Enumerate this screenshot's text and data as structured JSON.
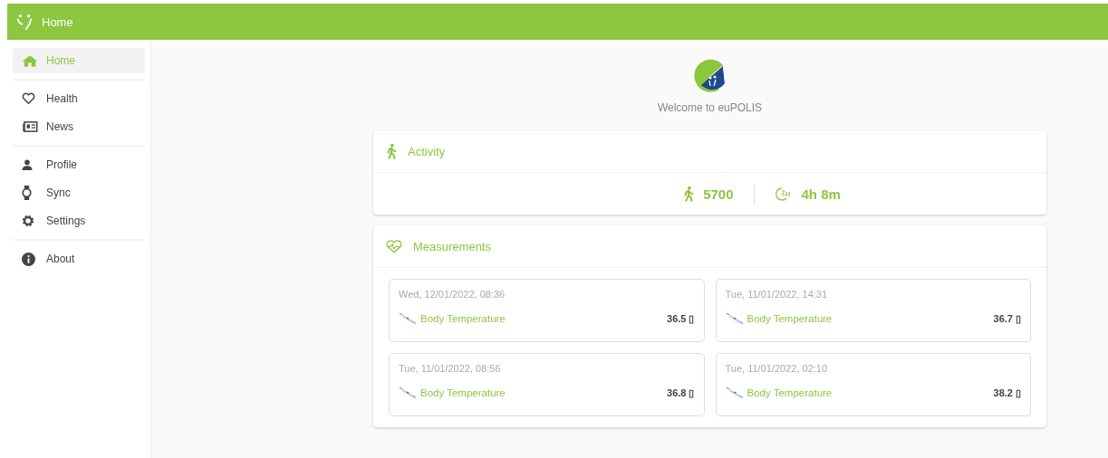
{
  "app_bar": {
    "title": "Home"
  },
  "sidebar": {
    "groups": [
      {
        "items": [
          {
            "label": "Home",
            "kind": "home",
            "selected": true
          }
        ]
      },
      {
        "items": [
          {
            "label": "Health",
            "kind": "heart",
            "selected": false
          },
          {
            "label": "News",
            "kind": "news",
            "selected": false
          }
        ]
      },
      {
        "items": [
          {
            "label": "Profile",
            "kind": "person",
            "selected": false
          },
          {
            "label": "Sync",
            "kind": "watch",
            "selected": false
          },
          {
            "label": "Settings",
            "kind": "gear",
            "selected": false
          }
        ]
      },
      {
        "items": [
          {
            "label": "About",
            "kind": "info",
            "selected": false
          }
        ]
      }
    ]
  },
  "welcome": {
    "text": "Welcome to euPOLIS"
  },
  "activity": {
    "title": "Activity",
    "steps": "5700",
    "sleep": "4h 8m"
  },
  "measurements": {
    "title": "Measurements",
    "items": [
      {
        "date": "Wed, 12/01/2022, 08:36",
        "name": "Body Temperature",
        "value": "36.5 ▯"
      },
      {
        "date": "Tue, 11/01/2022, 14:31",
        "name": "Body Temperature",
        "value": "36.7 ▯"
      },
      {
        "date": "Tue, 11/01/2022, 08:56",
        "name": "Body Temperature",
        "value": "36.8 ▯"
      },
      {
        "date": "Tue, 11/01/2022, 02:10",
        "name": "Body Temperature",
        "value": "38.2 ▯"
      }
    ]
  }
}
